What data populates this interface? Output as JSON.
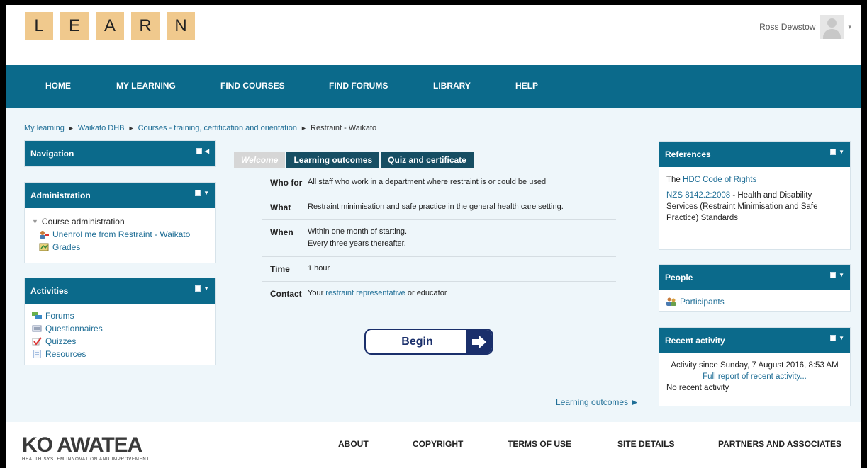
{
  "logo": {
    "letters": [
      "L",
      "E",
      "A",
      "R",
      "N"
    ]
  },
  "user": {
    "name": "Ross Dewstow",
    "caret": "▾"
  },
  "nav": {
    "items": [
      "HOME",
      "MY LEARNING",
      "FIND COURSES",
      "FIND FORUMS",
      "LIBRARY",
      "HELP"
    ]
  },
  "breadcrumb": {
    "items": [
      "My learning",
      "Waikato DHB",
      "Courses - training, certification and orientation",
      "Restraint - Waikato"
    ],
    "separator": "►"
  },
  "blocks": {
    "navigation": {
      "title": "Navigation"
    },
    "administration": {
      "title": "Administration",
      "section": "Course administration",
      "links": [
        "Unenrol me from Restraint - Waikato",
        "Grades"
      ]
    },
    "activities": {
      "title": "Activities",
      "links": [
        "Forums",
        "Questionnaires",
        "Quizzes",
        "Resources"
      ]
    },
    "references": {
      "title": "References",
      "line1_prefix": "The ",
      "line1_link": "HDC Code of Rights",
      "line2_link": "NZS 8142.2:2008",
      "line2_rest": " - Health and Disability Services (Restraint Minimisation and Safe Practice) Standards"
    },
    "people": {
      "title": "People",
      "link": "Participants"
    },
    "recent": {
      "title": "Recent activity",
      "since": "Activity since Sunday, 7 August 2016, 8:53 AM",
      "report_link": "Full report of recent activity...",
      "none": "No recent activity"
    }
  },
  "tabs": [
    "Welcome",
    "Learning outcomes",
    "Quiz and certificate"
  ],
  "info": {
    "who_label": "Who for",
    "who_value": "All staff who work in a department where restraint is or could be used",
    "what_label": "What",
    "what_value": "Restraint minimisation and safe practice in the general health care setting.",
    "when_label": "When",
    "when_value1": "Within one month of starting.",
    "when_value2": "Every three years thereafter.",
    "time_label": "Time",
    "time_value": "1 hour",
    "contact_label": "Contact",
    "contact_prefix": "Your ",
    "contact_link": "restraint representative",
    "contact_suffix": " or educator"
  },
  "begin": {
    "label": "Begin"
  },
  "next_link": {
    "label": "Learning outcomes ►"
  },
  "footer": {
    "logo_text": "KO AWATEA",
    "logo_tagline": "HEALTH SYSTEM INNOVATION AND IMPROVEMENT",
    "items": [
      "ABOUT",
      "COPYRIGHT",
      "TERMS OF USE",
      "SITE DETAILS",
      "PARTNERS AND ASSOCIATES"
    ]
  },
  "colors": {
    "brand": "#0b6a8b",
    "tile": "#f0c98d",
    "link": "#1f6e96",
    "begin": "#1a2f6b"
  }
}
